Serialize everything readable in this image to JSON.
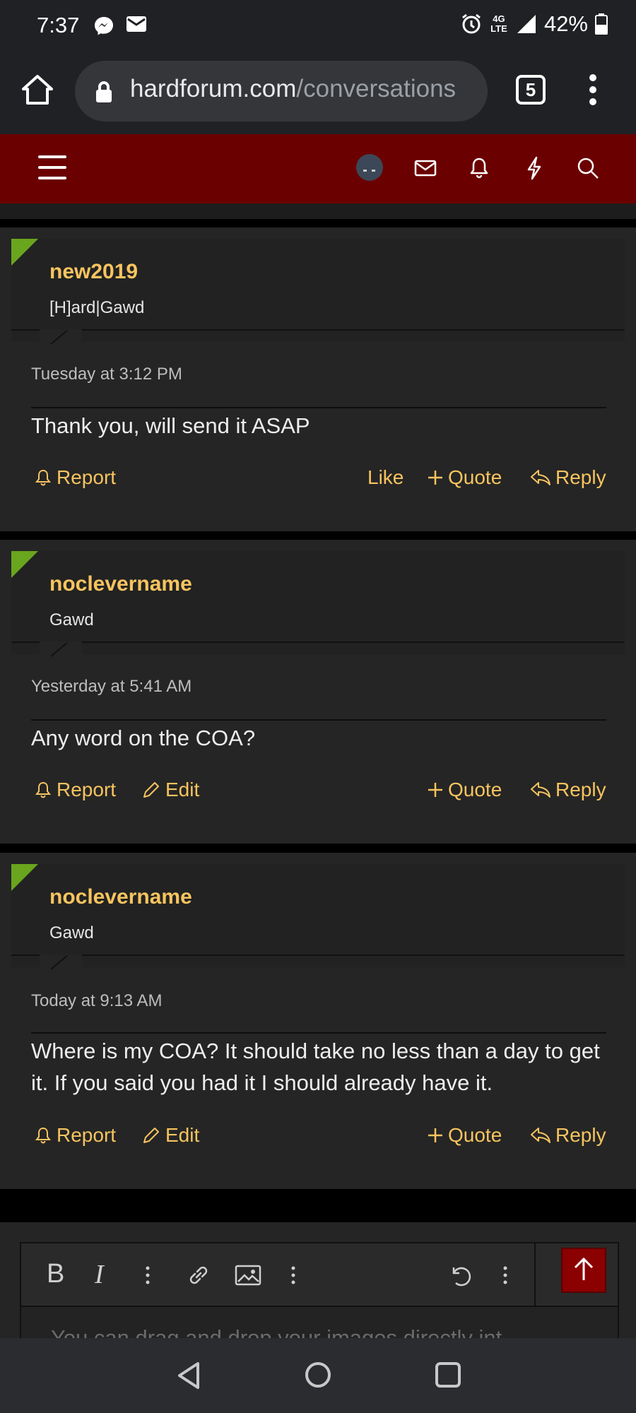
{
  "status_bar": {
    "time": "7:37",
    "network": "4G LTE",
    "battery": "42%",
    "icons": [
      "messenger-icon",
      "mail-icon",
      "alarm-icon",
      "signal-icon",
      "battery-icon"
    ]
  },
  "browser": {
    "url_domain": "hardforum.com",
    "url_path": "/conversations",
    "tab_count": "5"
  },
  "site_header": {
    "icons": [
      "menu-icon",
      "avatar",
      "inbox-icon",
      "bell-icon",
      "bolt-icon",
      "search-icon"
    ],
    "brand_color": "#6b0000"
  },
  "posts": [
    {
      "username": "new2019",
      "user_title": "[H]ard|Gawd",
      "date": "Tuesday at 3:12 PM",
      "body": "Thank you, will send it ASAP",
      "actions": {
        "report": "Report",
        "like": "Like",
        "quote": "Quote",
        "reply": "Reply"
      }
    },
    {
      "username": "noclevername",
      "user_title": "Gawd",
      "date": "Yesterday at 5:41 AM",
      "body": "Any word on the COA?",
      "actions": {
        "report": "Report",
        "edit": "Edit",
        "quote": "Quote",
        "reply": "Reply"
      }
    },
    {
      "username": "noclevername",
      "user_title": "Gawd",
      "date": "Today at 9:13 AM",
      "body": "Where is my COA? It should take no less than a day to get it. If you said you had it I should already have it.",
      "actions": {
        "report": "Report",
        "edit": "Edit",
        "quote": "Quote",
        "reply": "Reply"
      }
    }
  ],
  "editor": {
    "bold": "B",
    "italic": "I",
    "placeholder": "You can drag and drop your images directly int"
  },
  "colors": {
    "accent": "#f7c45f",
    "user_marker": "#6aa51e",
    "post_bg": "#252525"
  }
}
